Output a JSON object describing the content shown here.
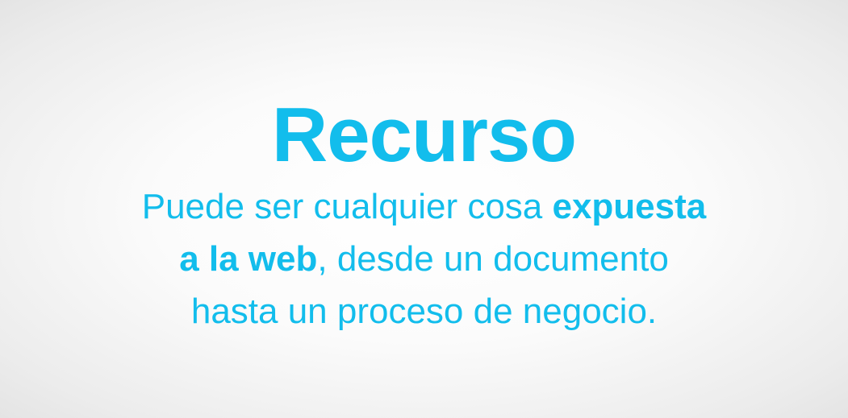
{
  "slide": {
    "title": "Recurso",
    "lines": [
      {
        "normal": "Puede ser cualquier cosa ",
        "bold": "expuesta",
        "rest": ""
      },
      {
        "normal": "",
        "bold": "a la web",
        "rest": ", desde un documento"
      },
      {
        "normal": "hasta un proceso de negocio.",
        "bold": "",
        "rest": ""
      }
    ]
  },
  "colors": {
    "accent": "#12bdec"
  }
}
